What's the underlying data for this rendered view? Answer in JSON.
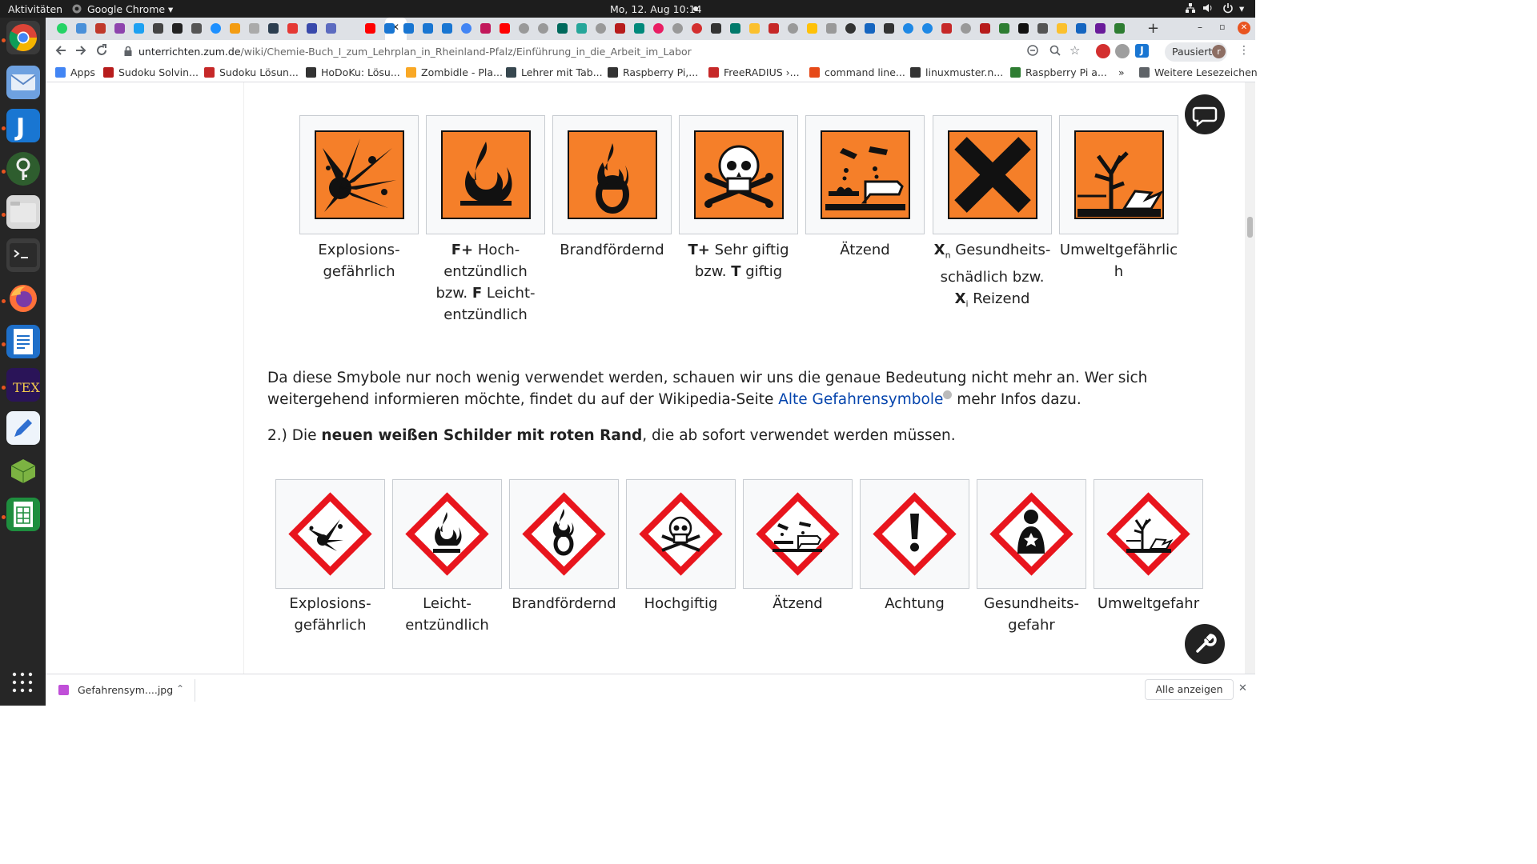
{
  "system": {
    "activities": "Aktivitäten",
    "app_name": "Google Chrome",
    "clock": "Mo, 12. Aug  10:14"
  },
  "browser": {
    "url_host": "unterrichten.zum.de",
    "url_path": "/wiki/Chemie-Buch_I_zum_Lehrplan_in_Rheinland-Pfalz/Einführung_in_die_Arbeit_im_Labor",
    "profile_label": "Pausiert",
    "profile_initial": "r",
    "new_tab": "+"
  },
  "bookmarks": {
    "items": [
      {
        "label": "Apps",
        "color": "#4285f4"
      },
      {
        "label": "Sudoku Solvin...",
        "color": "#b71c1c"
      },
      {
        "label": "Sudoku Lösun...",
        "color": "#c62828"
      },
      {
        "label": "HoDoKu: Lösu...",
        "color": "#333333"
      },
      {
        "label": "Zombidle - Pla...",
        "color": "#f9a825"
      },
      {
        "label": "Lehrer mit Tab...",
        "color": "#37474f"
      },
      {
        "label": "Raspberry Pi,...",
        "color": "#333333"
      },
      {
        "label": "FreeRADIUS ›...",
        "color": "#c62828"
      },
      {
        "label": "command line...",
        "color": "#e64a19"
      },
      {
        "label": "linuxmuster.n...",
        "color": "#333333"
      },
      {
        "label": "Raspberry Pi a...",
        "color": "#2e7d32"
      }
    ],
    "more": "»",
    "other": "Weitere Lesezeichen"
  },
  "old_symbols": [
    {
      "icon": "explosion-icon",
      "lines": [
        {
          "b": "",
          "t": "Explosions-"
        },
        {
          "b": "",
          "t": "gefährlich"
        }
      ]
    },
    {
      "icon": "flame-icon",
      "lines": [
        {
          "b": "F+",
          "t": " Hoch-"
        },
        {
          "b": "",
          "t": "entzündlich"
        },
        {
          "b": "",
          "t": "bzw. "
        },
        {
          "b": "",
          "t": "entzündlich"
        }
      ]
    },
    {
      "icon": "flame-over-circle-icon",
      "lines": [
        {
          "b": "",
          "t": "Brandfördernd"
        }
      ]
    },
    {
      "icon": "skull-crossbones-icon",
      "lines": [
        {
          "b": "T+",
          "t": " Sehr giftig"
        },
        {
          "b": "",
          "t": "bzw. "
        }
      ]
    },
    {
      "icon": "corrosion-icon",
      "lines": [
        {
          "b": "",
          "t": "Ätzend"
        }
      ]
    },
    {
      "icon": "cross-icon",
      "lines": [
        {
          "b": "",
          "t": " Gesundheits-"
        },
        {
          "b": "",
          "t": "schädlich bzw."
        },
        {
          "b": "",
          "t": " Reizend"
        }
      ]
    },
    {
      "icon": "environment-icon",
      "lines": [
        {
          "b": "",
          "t": "Umweltgefährlic"
        },
        {
          "b": "",
          "t": "h"
        }
      ]
    }
  ],
  "old_extra": {
    "f_bold": "F",
    "f_rest": " Leicht-",
    "t_bold": "T",
    "t_rest": " giftig",
    "xn_x": "X",
    "xn_sub": "n",
    "xi_x": "X",
    "xi_sub": "i"
  },
  "paragraph1": {
    "text": "Da diese Smybole nur noch wenig verwendet werden, schauen wir uns die genaue Bedeutung nicht mehr an. Wer sich weitergehend informieren möchte, findet du auf der Wikipedia-Seite ",
    "link": "Alte Gefahrensymbole",
    "after": " mehr Infos dazu."
  },
  "paragraph2": {
    "prefix": "2.) Die ",
    "bold": "neuen weißen Schilder mit roten Rand",
    "suffix": ", die ab sofort verwendet werden müssen."
  },
  "new_symbols": [
    {
      "icon": "ghs-explosion-icon",
      "lines": [
        "Explosions-",
        "gefährlich"
      ]
    },
    {
      "icon": "ghs-flame-icon",
      "lines": [
        "Leicht-",
        "entzündlich"
      ]
    },
    {
      "icon": "ghs-flame-over-circle-icon",
      "lines": [
        "Brandfördernd"
      ]
    },
    {
      "icon": "ghs-skull-icon",
      "lines": [
        "Hochgiftig"
      ]
    },
    {
      "icon": "ghs-corrosion-icon",
      "lines": [
        "Ätzend"
      ]
    },
    {
      "icon": "ghs-exclamation-icon",
      "lines": [
        "Achtung"
      ]
    },
    {
      "icon": "ghs-health-hazard-icon",
      "lines": [
        "Gesundheits-",
        "gefahr"
      ]
    },
    {
      "icon": "ghs-environment-icon",
      "lines": [
        "Umweltgefahr"
      ]
    }
  ],
  "download": {
    "file": "Gefahrensym....jpg",
    "show_all": "Alle anzeigen",
    "close": "✕"
  },
  "colors": {
    "hazard_orange": "#f57f29",
    "ghs_red": "#e8151d",
    "link": "#0645ad"
  }
}
